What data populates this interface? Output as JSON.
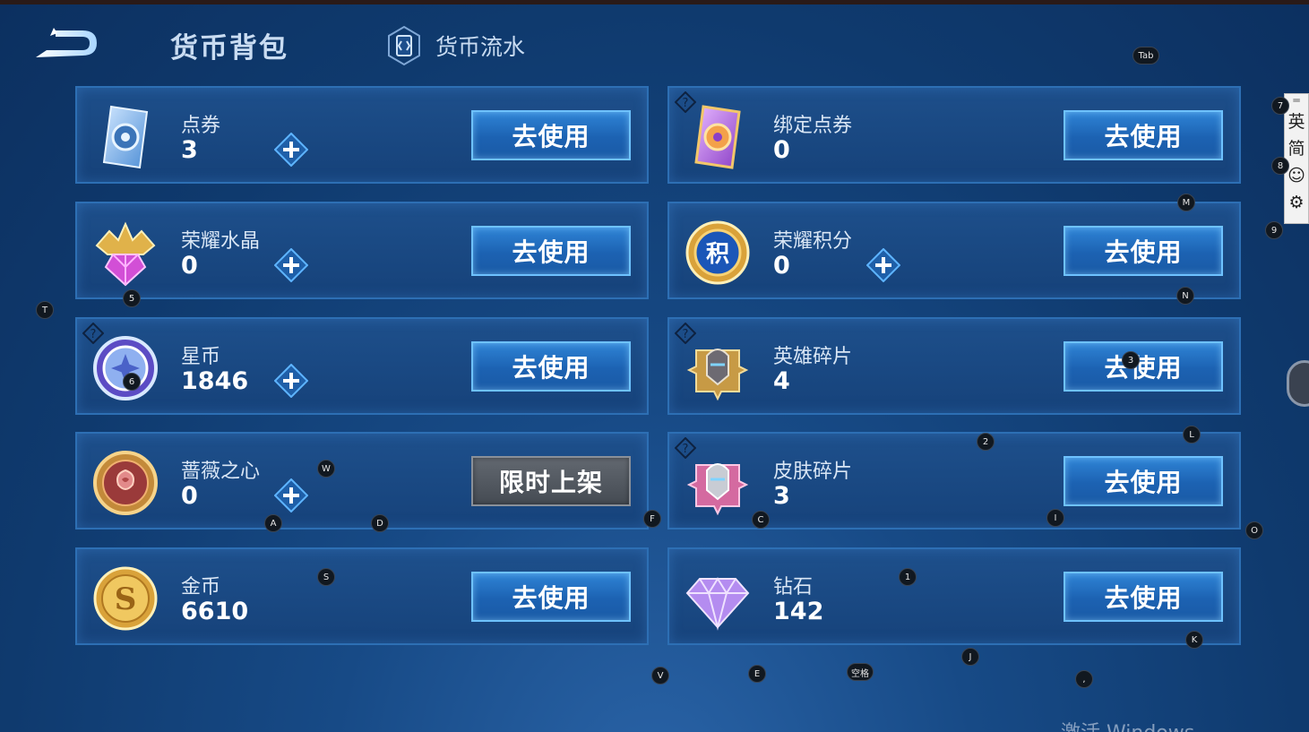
{
  "header": {
    "title": "货币背包",
    "flow_tab": "货币流水"
  },
  "cards": [
    {
      "name": "点券",
      "amount": "3",
      "button": "去使用",
      "has_plus": true,
      "has_help": false,
      "icon": "coupon-icon"
    },
    {
      "name": "绑定点券",
      "amount": "0",
      "button": "去使用",
      "has_plus": false,
      "has_help": true,
      "icon": "bound-coupon-icon"
    },
    {
      "name": "荣耀水晶",
      "amount": "0",
      "button": "去使用",
      "has_plus": true,
      "has_help": false,
      "icon": "glory-crystal-icon"
    },
    {
      "name": "荣耀积分",
      "amount": "0",
      "button": "去使用",
      "has_plus": true,
      "has_help": false,
      "icon": "glory-points-icon"
    },
    {
      "name": "星币",
      "amount": "1846",
      "button": "去使用",
      "has_plus": true,
      "has_help": true,
      "icon": "star-coin-icon"
    },
    {
      "name": "英雄碎片",
      "amount": "4",
      "button": "去使用",
      "has_plus": false,
      "has_help": true,
      "icon": "hero-fragment-icon"
    },
    {
      "name": "蔷薇之心",
      "amount": "0",
      "button": "限时上架",
      "has_plus": true,
      "has_help": false,
      "icon": "rose-heart-icon"
    },
    {
      "name": "皮肤碎片",
      "amount": "3",
      "button": "去使用",
      "has_plus": false,
      "has_help": true,
      "icon": "skin-fragment-icon"
    },
    {
      "name": "金币",
      "amount": "6610",
      "button": "去使用",
      "has_plus": false,
      "has_help": false,
      "icon": "gold-coin-icon"
    },
    {
      "name": "钻石",
      "amount": "142",
      "button": "去使用",
      "has_plus": false,
      "has_help": false,
      "icon": "diamond-icon"
    }
  ],
  "ime": {
    "bar": "═",
    "lang": "英",
    "script": "简",
    "emoji": "☺",
    "settings": "⚙"
  },
  "key_hints": [
    "Tab",
    "7",
    "8",
    "9",
    "M",
    "N",
    "T",
    "5",
    "6",
    "3",
    "2",
    "L",
    "W",
    "A",
    "D",
    "F",
    "C",
    "I",
    "O",
    "S",
    "1",
    "K",
    "J",
    "V",
    "E",
    "空格",
    ","
  ],
  "watermark": "激活 Windows",
  "colors": {
    "background": "#174a86",
    "button_blue": "#1c62b2",
    "button_border": "#6ec2ff",
    "button_gray": "#454b53"
  }
}
